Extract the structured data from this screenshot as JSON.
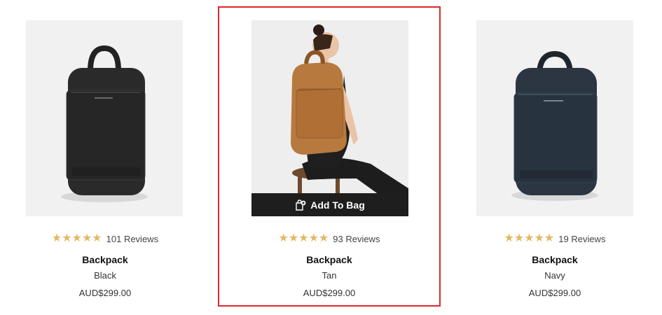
{
  "products": [
    {
      "name": "Backpack",
      "color": "Black",
      "price": "AUD$299.00",
      "reviews": "101 Reviews",
      "stars": 5
    },
    {
      "name": "Backpack",
      "color": "Tan",
      "price": "AUD$299.00",
      "reviews": "93 Reviews",
      "stars": 5
    },
    {
      "name": "Backpack",
      "color": "Navy",
      "price": "AUD$299.00",
      "reviews": "19 Reviews",
      "stars": 5
    }
  ],
  "add_to_bag_label": "Add To Bag",
  "colors": {
    "highlight": "#e02727",
    "star": "#e3b863",
    "bag_button": "#1e1e1e",
    "backpack_black": "#2a2a2a",
    "backpack_tan": "#b8793f",
    "backpack_navy": "#2b3642"
  },
  "icons": {
    "star": "star-icon",
    "bag": "bag-icon"
  }
}
